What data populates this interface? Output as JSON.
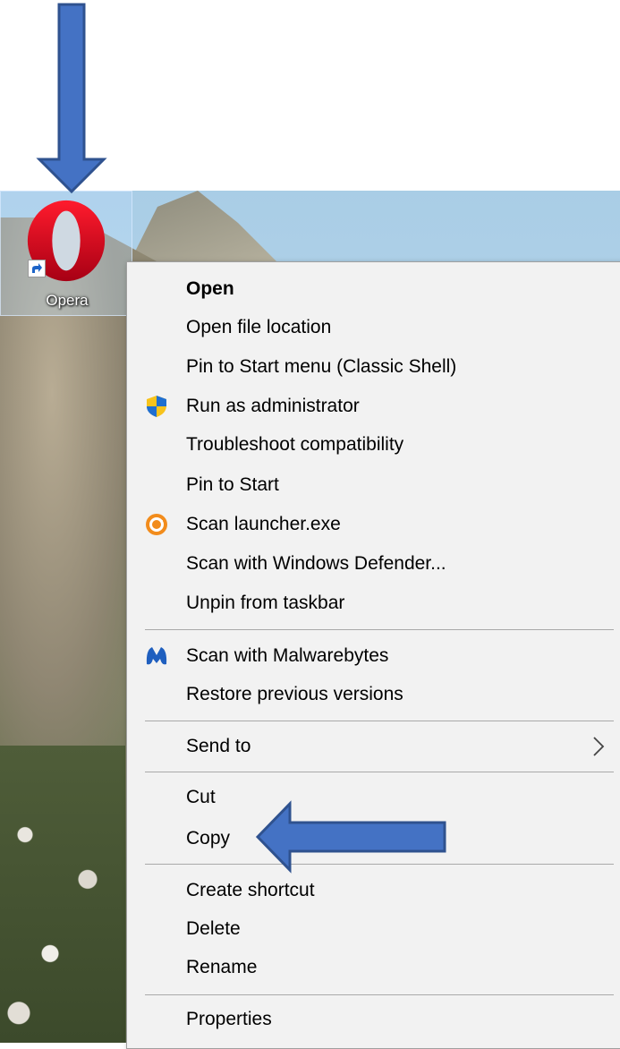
{
  "desktop": {
    "icon_label": "Opera"
  },
  "context_menu": {
    "items": [
      {
        "label": "Open",
        "bold": true
      },
      {
        "label": "Open file location"
      },
      {
        "label": "Pin to Start menu (Classic Shell)"
      },
      {
        "label": "Run as administrator",
        "icon": "uac-shield-icon"
      },
      {
        "label": "Troubleshoot compatibility"
      },
      {
        "label": "Pin to Start"
      },
      {
        "label": "Scan launcher.exe",
        "icon": "avast-icon"
      },
      {
        "label": "Scan with Windows Defender..."
      },
      {
        "label": "Unpin from taskbar"
      },
      {
        "label": "Scan with Malwarebytes",
        "icon": "malwarebytes-icon"
      },
      {
        "label": "Restore previous versions"
      },
      {
        "label": "Send to",
        "submenu": true
      },
      {
        "label": "Cut"
      },
      {
        "label": "Copy"
      },
      {
        "label": "Create shortcut"
      },
      {
        "label": "Delete"
      },
      {
        "label": "Rename"
      },
      {
        "label": "Properties"
      }
    ]
  },
  "colors": {
    "arrow_fill": "#4472c4",
    "arrow_stroke": "#2f528f",
    "menu_background": "#f2f2f2",
    "opera_red": "#e2152b"
  }
}
